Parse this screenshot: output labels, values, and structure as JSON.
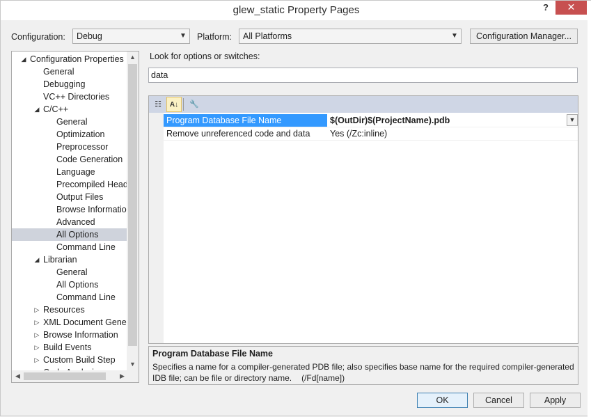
{
  "window": {
    "title": "glew_static Property Pages",
    "help_label": "?",
    "close_label": "✕"
  },
  "top": {
    "configuration_label": "Configuration:",
    "configuration_value": "Debug",
    "platform_label": "Platform:",
    "platform_value": "All Platforms",
    "config_manager_label": "Configuration Manager..."
  },
  "tree": {
    "items": [
      {
        "label": "Configuration Properties",
        "toggle": "◢",
        "level": 0
      },
      {
        "label": "General",
        "toggle": "",
        "level": 1
      },
      {
        "label": "Debugging",
        "toggle": "",
        "level": 1
      },
      {
        "label": "VC++ Directories",
        "toggle": "",
        "level": 1
      },
      {
        "label": "C/C++",
        "toggle": "◢",
        "level": 1
      },
      {
        "label": "General",
        "toggle": "",
        "level": 2
      },
      {
        "label": "Optimization",
        "toggle": "",
        "level": 2
      },
      {
        "label": "Preprocessor",
        "toggle": "",
        "level": 2
      },
      {
        "label": "Code Generation",
        "toggle": "",
        "level": 2
      },
      {
        "label": "Language",
        "toggle": "",
        "level": 2
      },
      {
        "label": "Precompiled Heade",
        "toggle": "",
        "level": 2
      },
      {
        "label": "Output Files",
        "toggle": "",
        "level": 2
      },
      {
        "label": "Browse Information",
        "toggle": "",
        "level": 2
      },
      {
        "label": "Advanced",
        "toggle": "",
        "level": 2
      },
      {
        "label": "All Options",
        "toggle": "",
        "level": 2,
        "selected": true
      },
      {
        "label": "Command Line",
        "toggle": "",
        "level": 2
      },
      {
        "label": "Librarian",
        "toggle": "◢",
        "level": 1
      },
      {
        "label": "General",
        "toggle": "",
        "level": 2
      },
      {
        "label": "All Options",
        "toggle": "",
        "level": 2
      },
      {
        "label": "Command Line",
        "toggle": "",
        "level": 2
      },
      {
        "label": "Resources",
        "toggle": "▷",
        "level": 1
      },
      {
        "label": "XML Document Genera",
        "toggle": "▷",
        "level": 1
      },
      {
        "label": "Browse Information",
        "toggle": "▷",
        "level": 1
      },
      {
        "label": "Build Events",
        "toggle": "▷",
        "level": 1
      },
      {
        "label": "Custom Build Step",
        "toggle": "▷",
        "level": 1
      },
      {
        "label": "Code Analysis",
        "toggle": "▷",
        "level": 1
      }
    ]
  },
  "search": {
    "label": "Look for options or switches:",
    "value": "data"
  },
  "grid": {
    "toolbar": {
      "categorized_icon": "☷",
      "alphabetical_icon": "A↓",
      "property_pages_icon": "🔧"
    },
    "rows": [
      {
        "name": "Program Database File Name",
        "value": "$(OutDir)$(ProjectName).pdb",
        "selected": true
      },
      {
        "name": "Remove unreferenced code and data",
        "value": "Yes (/Zc:inline)",
        "selected": false
      }
    ]
  },
  "description": {
    "title": "Program Database File Name",
    "text": "Specifies a name for a compiler-generated PDB file; also specifies base name for the required compiler-generated IDB file; can be file or directory name.",
    "switch": "(/Fd[name])"
  },
  "buttons": {
    "ok": "OK",
    "cancel": "Cancel",
    "apply": "Apply"
  }
}
